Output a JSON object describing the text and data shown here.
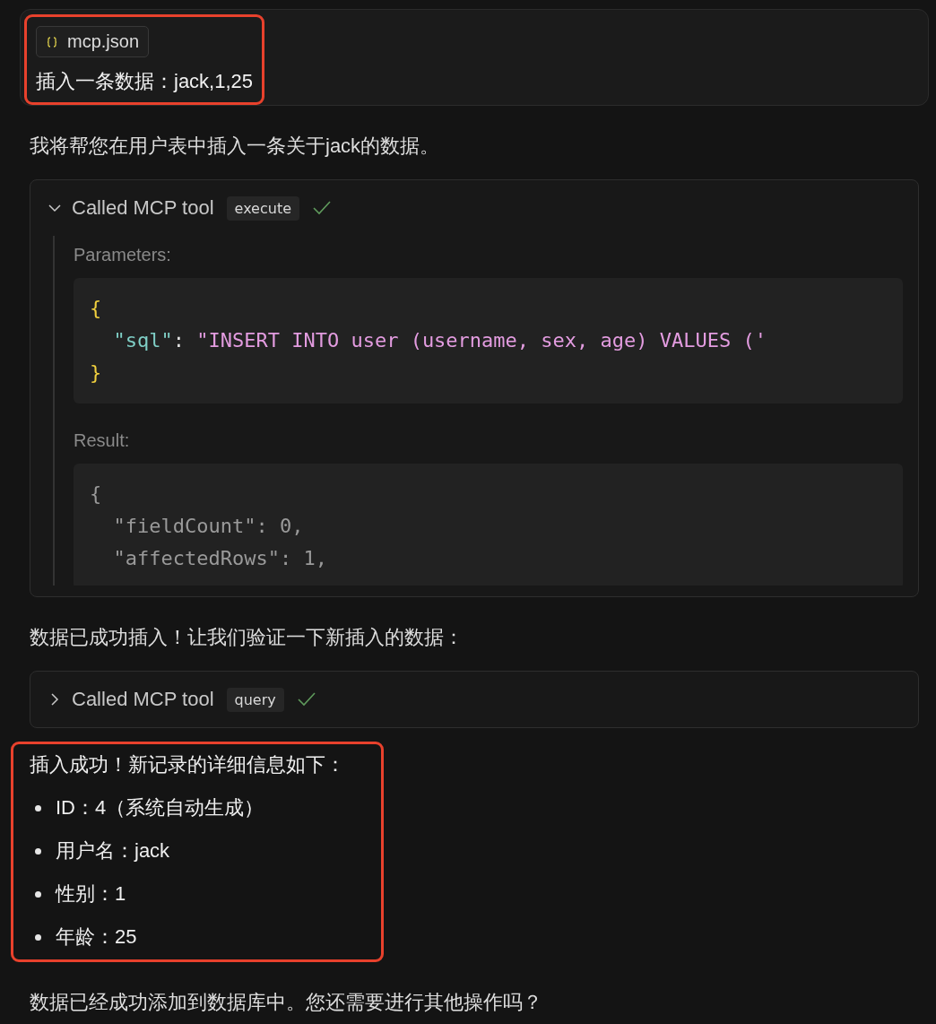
{
  "user_message": {
    "attachment": "mcp.json",
    "text": "插入一条数据：jack,1,25",
    "highlighted": true
  },
  "messages": [
    {
      "kind": "text",
      "text": "我将帮您在用户表中插入一条关于jack的数据。"
    },
    {
      "kind": "tool",
      "label": "Called MCP tool",
      "tool": "execute",
      "expanded": true,
      "succeeded": true,
      "parameters_label": "Parameters:",
      "parameters": [
        [
          {
            "kind": "brace",
            "text": "{"
          }
        ],
        [
          {
            "kind": "key",
            "text": "\"sql\""
          },
          {
            "kind": "punct",
            "text": ": "
          },
          {
            "kind": "string",
            "text": "\"INSERT INTO user (username, sex, age) VALUES ('"
          }
        ],
        [
          {
            "kind": "brace",
            "text": "}"
          }
        ]
      ],
      "result_label": "Result:",
      "result": [
        "{",
        "  \"fieldCount\": 0,",
        "  \"affectedRows\": 1,"
      ]
    },
    {
      "kind": "text",
      "text": "数据已成功插入！让我们验证一下新插入的数据："
    },
    {
      "kind": "tool",
      "label": "Called MCP tool",
      "tool": "query",
      "expanded": false,
      "succeeded": true
    },
    {
      "kind": "list",
      "highlighted": true,
      "intro": "插入成功！新记录的详细信息如下：",
      "items": [
        "ID：4（系统自动生成）",
        "用户名：jack",
        "性别：1",
        "年龄：25"
      ]
    },
    {
      "kind": "text",
      "text": "数据已经成功添加到数据库中。您还需要进行其他操作吗？"
    }
  ]
}
